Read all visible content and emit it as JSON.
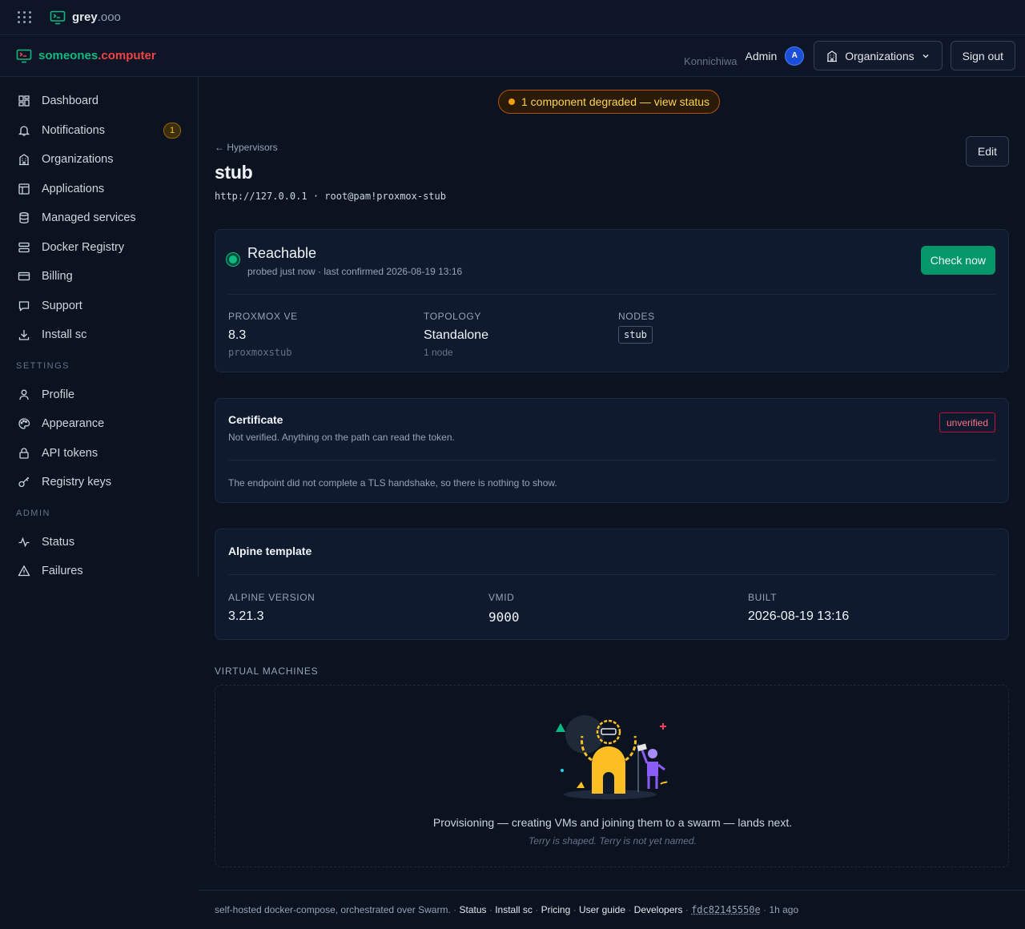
{
  "progress": {
    "fraction": 0.46
  },
  "topbar": {
    "app_name": "grey",
    "app_tld": ".ooo",
    "apps_icon": "grid-dots-icon",
    "logo_icon": "terminal-monitor-icon"
  },
  "header": {
    "brand_a": "someones",
    "brand_b": ".computer",
    "greeting": "Konnichiwa",
    "user": "Admin",
    "avatar_initial": "A",
    "org_button": "Organizations",
    "sign_out": "Sign out"
  },
  "sidebar": {
    "items": [
      {
        "label": "Dashboard",
        "icon": "dashboard-grid-icon"
      },
      {
        "label": "Notifications",
        "icon": "bell-icon",
        "badge": "1"
      },
      {
        "label": "Organizations",
        "icon": "building-icon"
      },
      {
        "label": "Applications",
        "icon": "window-icon"
      },
      {
        "label": "Managed services",
        "icon": "database-icon"
      },
      {
        "label": "Docker Registry",
        "icon": "server-stack-icon"
      },
      {
        "label": "Billing",
        "icon": "credit-card-icon"
      },
      {
        "label": "Support",
        "icon": "chat-icon"
      },
      {
        "label": "Install sc",
        "icon": "download-icon"
      }
    ],
    "settings_heading": "SETTINGS",
    "settings": [
      {
        "label": "Profile",
        "icon": "user-icon"
      },
      {
        "label": "Appearance",
        "icon": "palette-icon"
      },
      {
        "label": "API tokens",
        "icon": "lock-icon"
      },
      {
        "label": "Registry keys",
        "icon": "key-icon"
      }
    ],
    "admin_heading": "ADMIN",
    "admin": [
      {
        "label": "Status",
        "icon": "activity-icon"
      },
      {
        "label": "Failures",
        "icon": "warning-triangle-icon"
      }
    ]
  },
  "main": {
    "status_banner": "1 component degraded — view status",
    "back_link": "← Hypervisors",
    "title": "stub",
    "subtitle": "http://127.0.0.1 · root@pam!proxmox-stub",
    "edit": "Edit"
  },
  "reach": {
    "title": "Reachable",
    "sub": "probed just now · last confirmed 2026-08-19 13:16",
    "check_now": "Check now",
    "proxmox_label": "PROXMOX VE",
    "proxmox_value": "8.3",
    "proxmox_sub": "proxmoxstub",
    "topology_label": "TOPOLOGY",
    "topology_value": "Standalone",
    "topology_sub": "1 node",
    "nodes_label": "NODES",
    "nodes": [
      "stub"
    ]
  },
  "certificate": {
    "title": "Certificate",
    "sub": "Not verified. Anything on the path can read the token.",
    "badge": "unverified",
    "note": "The endpoint did not complete a TLS handshake, so there is nothing to show."
  },
  "alpine": {
    "title": "Alpine template",
    "version_label": "ALPINE VERSION",
    "version": "3.21.3",
    "vmid_label": "VMID",
    "vmid": "9000",
    "built_label": "BUILT",
    "built": "2026-08-19 13:16"
  },
  "vms": {
    "heading": "VIRTUAL MACHINES",
    "message": "Provisioning — creating VMs and joining them to a swarm — lands next.",
    "note": "Terry is shaped. Terry is not yet named."
  },
  "footer": {
    "tagline": "self-hosted docker-compose, orchestrated over Swarm.",
    "links": [
      "Status",
      "Install sc",
      "Pricing",
      "User guide",
      "Developers"
    ],
    "commit": "fdc82145550e",
    "age": "1h ago"
  },
  "colors": {
    "accent_green": "#10b981",
    "brand_red": "#ef4444",
    "warn": "#f59e0b",
    "bg": "#0b1220"
  }
}
